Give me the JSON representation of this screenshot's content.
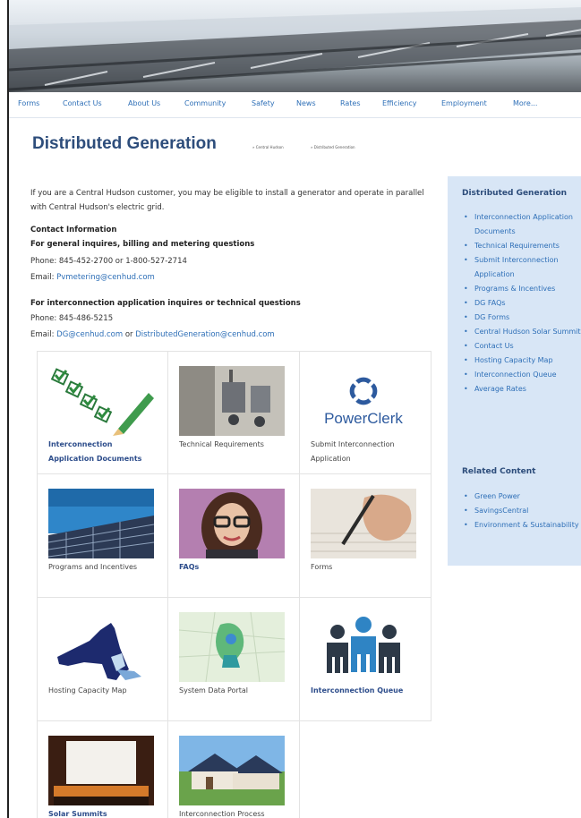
{
  "nav": [
    "Forms",
    "Contact Us",
    "About Us",
    "Community",
    "Safety",
    "News",
    "Rates",
    "Efficiency",
    "Employment",
    "More..."
  ],
  "page_title": "Distributed Generation",
  "breadcrumb": [
    "» Central Hudson",
    "» Distributed Generation"
  ],
  "intro": "If you are a Central Hudson customer, you may be eligible to install a generator and operate in parallel with Central Hudson's electric grid.",
  "contact": {
    "heading": "Contact Information",
    "general_heading": "For general inquires, billing and metering questions",
    "general_phone": "Phone: 845-452-2700 or 1-800-527-2714",
    "general_email_label": "Email:",
    "general_email": "Pvmetering@cenhud.com",
    "tech_heading": "For interconnection application inquires or technical questions",
    "tech_phone": "Phone: 845-486-5215",
    "tech_email_label": "Email:",
    "tech_email_1": "DG@cenhud.com",
    "tech_email_or": "or",
    "tech_email_2": "DistributedGeneration@cenhud.com"
  },
  "tiles": [
    {
      "label": "Interconnection Application Documents",
      "link": true,
      "icon": "checklist-icon"
    },
    {
      "label": "Technical Requirements",
      "link": false,
      "icon": "electrical-panel-icon"
    },
    {
      "label": "Submit Interconnection Application",
      "link": false,
      "icon": "powerclerk-logo",
      "logo_text": "PowerClerk"
    },
    {
      "label": "Programs and Incentives",
      "link": false,
      "icon": "solar-array-icon"
    },
    {
      "label": "FAQs",
      "link": true,
      "icon": "person-headset-icon"
    },
    {
      "label": "Forms",
      "link": false,
      "icon": "hand-writing-icon"
    },
    {
      "label": "Hosting Capacity Map",
      "link": false,
      "icon": "new-york-map-icon"
    },
    {
      "label": "System Data Portal",
      "link": false,
      "icon": "data-map-icon"
    },
    {
      "label": "Interconnection Queue",
      "link": true,
      "icon": "people-queue-icon"
    },
    {
      "label": "Solar Summits",
      "link": true,
      "icon": "stage-icon"
    },
    {
      "label": "Interconnection Process",
      "link": false,
      "icon": "solar-house-icon"
    }
  ],
  "sidebar": {
    "heading": "Distributed Generation",
    "items": [
      "Interconnection Application Documents",
      "Technical Requirements",
      "Submit Interconnection Application",
      "Programs & Incentives",
      "DG FAQs",
      "DG Forms",
      "Central Hudson Solar Summits",
      "Contact Us",
      "Hosting Capacity Map",
      "Interconnection Queue",
      "Average Rates"
    ],
    "related_heading": "Related Content",
    "related_items": [
      "Green Power",
      "SavingsCentral",
      "Environment & Sustainability"
    ]
  },
  "colors": {
    "link": "#2e6fb7",
    "title": "#2d4d7b",
    "sidebar_bg": "#d8e6f6"
  }
}
